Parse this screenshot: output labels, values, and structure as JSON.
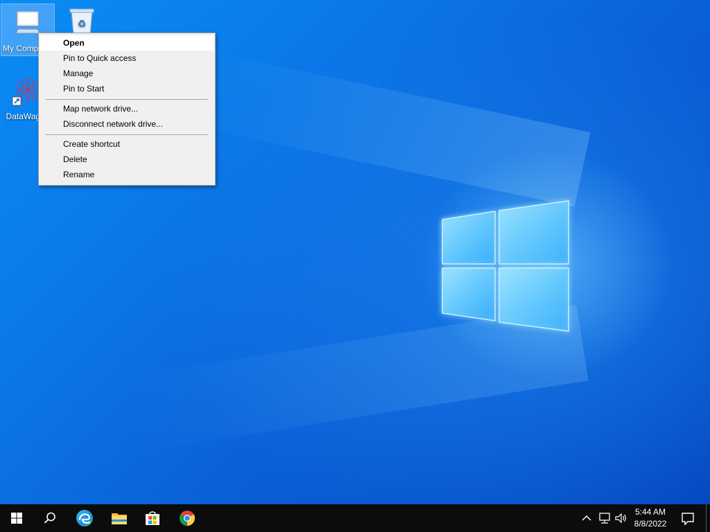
{
  "desktop": {
    "icons": [
      {
        "label": "My Computer",
        "icon": "computer-icon"
      },
      {
        "label": "",
        "icon": "recycle-bin-icon"
      },
      {
        "label": "DataWagon",
        "icon": "app-shortcut-icon"
      }
    ]
  },
  "context_menu": {
    "items": [
      {
        "label": "Open",
        "bold": true,
        "highlighted": true
      },
      {
        "label": "Pin to Quick access"
      },
      {
        "label": "Manage"
      },
      {
        "label": "Pin to Start"
      },
      {
        "label": "Map network drive..."
      },
      {
        "label": "Disconnect network drive..."
      },
      {
        "label": "Create shortcut"
      },
      {
        "label": "Delete"
      },
      {
        "label": "Rename"
      }
    ]
  },
  "taskbar": {
    "buttons": [
      {
        "name": "start",
        "icon": "windows-start-icon"
      },
      {
        "name": "search",
        "icon": "search-icon"
      },
      {
        "name": "edge",
        "icon": "edge-browser-icon"
      },
      {
        "name": "file-explorer",
        "icon": "folder-icon"
      },
      {
        "name": "store",
        "icon": "store-icon"
      },
      {
        "name": "chrome",
        "icon": "chrome-icon"
      }
    ],
    "tray": {
      "time": "5:44 AM",
      "date": "8/8/2022"
    }
  },
  "colors": {
    "desktop_blue": "#0b74e6",
    "taskbar": "#0c0c0c",
    "menu_bg": "#f0f0f0"
  }
}
